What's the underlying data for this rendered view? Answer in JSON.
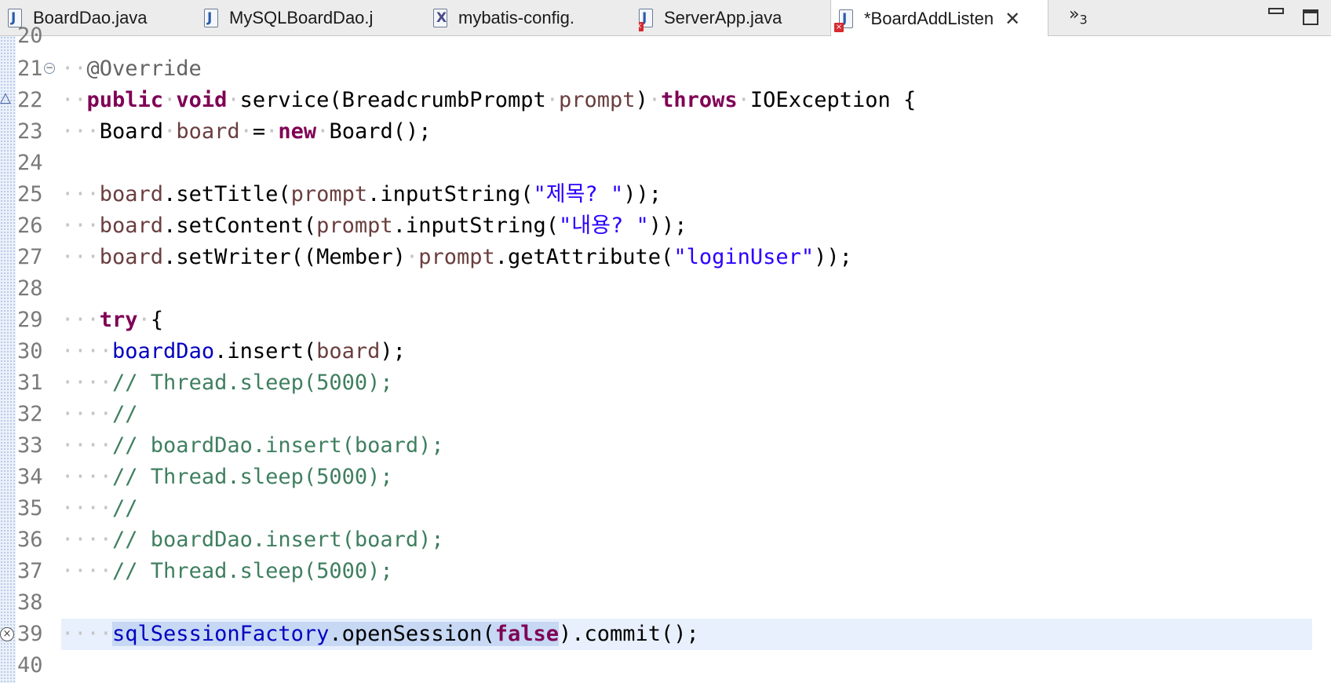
{
  "tabs": [
    {
      "label": "BoardDao.java",
      "icon": "java-file-icon",
      "glyph": "J"
    },
    {
      "label": "MySQLBoardDao.j",
      "icon": "java-file-icon",
      "glyph": "J"
    },
    {
      "label": "mybatis-config.",
      "icon": "xml-file-icon",
      "glyph": "X"
    },
    {
      "label": "ServerApp.java",
      "icon": "java-file-error-icon",
      "glyph": "J"
    },
    {
      "label": "*BoardAddListen",
      "icon": "java-file-error-icon",
      "glyph": "J",
      "active": true
    }
  ],
  "overflow": {
    "glyph": "»",
    "count": "3"
  },
  "editor": {
    "first_line": 20,
    "current_line": 39,
    "lines": [
      {
        "n": "20"
      },
      {
        "n": "21"
      },
      {
        "n": "22"
      },
      {
        "n": "23"
      },
      {
        "n": "24"
      },
      {
        "n": "25"
      },
      {
        "n": "26"
      },
      {
        "n": "27"
      },
      {
        "n": "28"
      },
      {
        "n": "29"
      },
      {
        "n": "30"
      },
      {
        "n": "31"
      },
      {
        "n": "32"
      },
      {
        "n": "33"
      },
      {
        "n": "34"
      },
      {
        "n": "35"
      },
      {
        "n": "36"
      },
      {
        "n": "37"
      },
      {
        "n": "38"
      },
      {
        "n": "39"
      },
      {
        "n": "40"
      }
    ],
    "code": {
      "l21_ann": "@Override",
      "l22_public": "public",
      "l22_void": "void",
      "l22_method": "service(BreadcrumbPrompt",
      "l22_param": "prompt",
      "l22_close": ")",
      "l22_throws": "throws",
      "l22_exc": "IOException {",
      "l23_type": "Board",
      "l23_var": "board",
      "l23_eq": "=",
      "l23_new": "new",
      "l23_ctor": "Board();",
      "l25_var": "board",
      "l25_call": ".setTitle(",
      "l25_arg": "prompt",
      "l25_call2": ".inputString(",
      "l25_str": "\"제목? \"",
      "l25_end": "));",
      "l26_var": "board",
      "l26_call": ".setContent(",
      "l26_arg": "prompt",
      "l26_call2": ".inputString(",
      "l26_str": "\"내용? \"",
      "l26_end": "));",
      "l27_var": "board",
      "l27_call": ".setWriter((Member)",
      "l27_arg": "prompt",
      "l27_call2": ".getAttribute(",
      "l27_str": "\"loginUser\"",
      "l27_end": "));",
      "l29_try": "try",
      "l29_brace": "{",
      "l30_field": "boardDao",
      "l30_call": ".insert(",
      "l30_arg": "board",
      "l30_end": ");",
      "l31_cm": "// Thread.sleep(5000);",
      "l32_cm": "//",
      "l33_cm": "// boardDao.insert(board);",
      "l34_cm": "// Thread.sleep(5000);",
      "l35_cm": "//",
      "l36_cm": "// boardDao.insert(board);",
      "l37_cm": "// Thread.sleep(5000);",
      "l39_field": "sqlSessionFactory",
      "l39_call": ".openSession(",
      "l39_false": "false",
      "l39_close": ")",
      "l39_end": ".commit();"
    }
  }
}
